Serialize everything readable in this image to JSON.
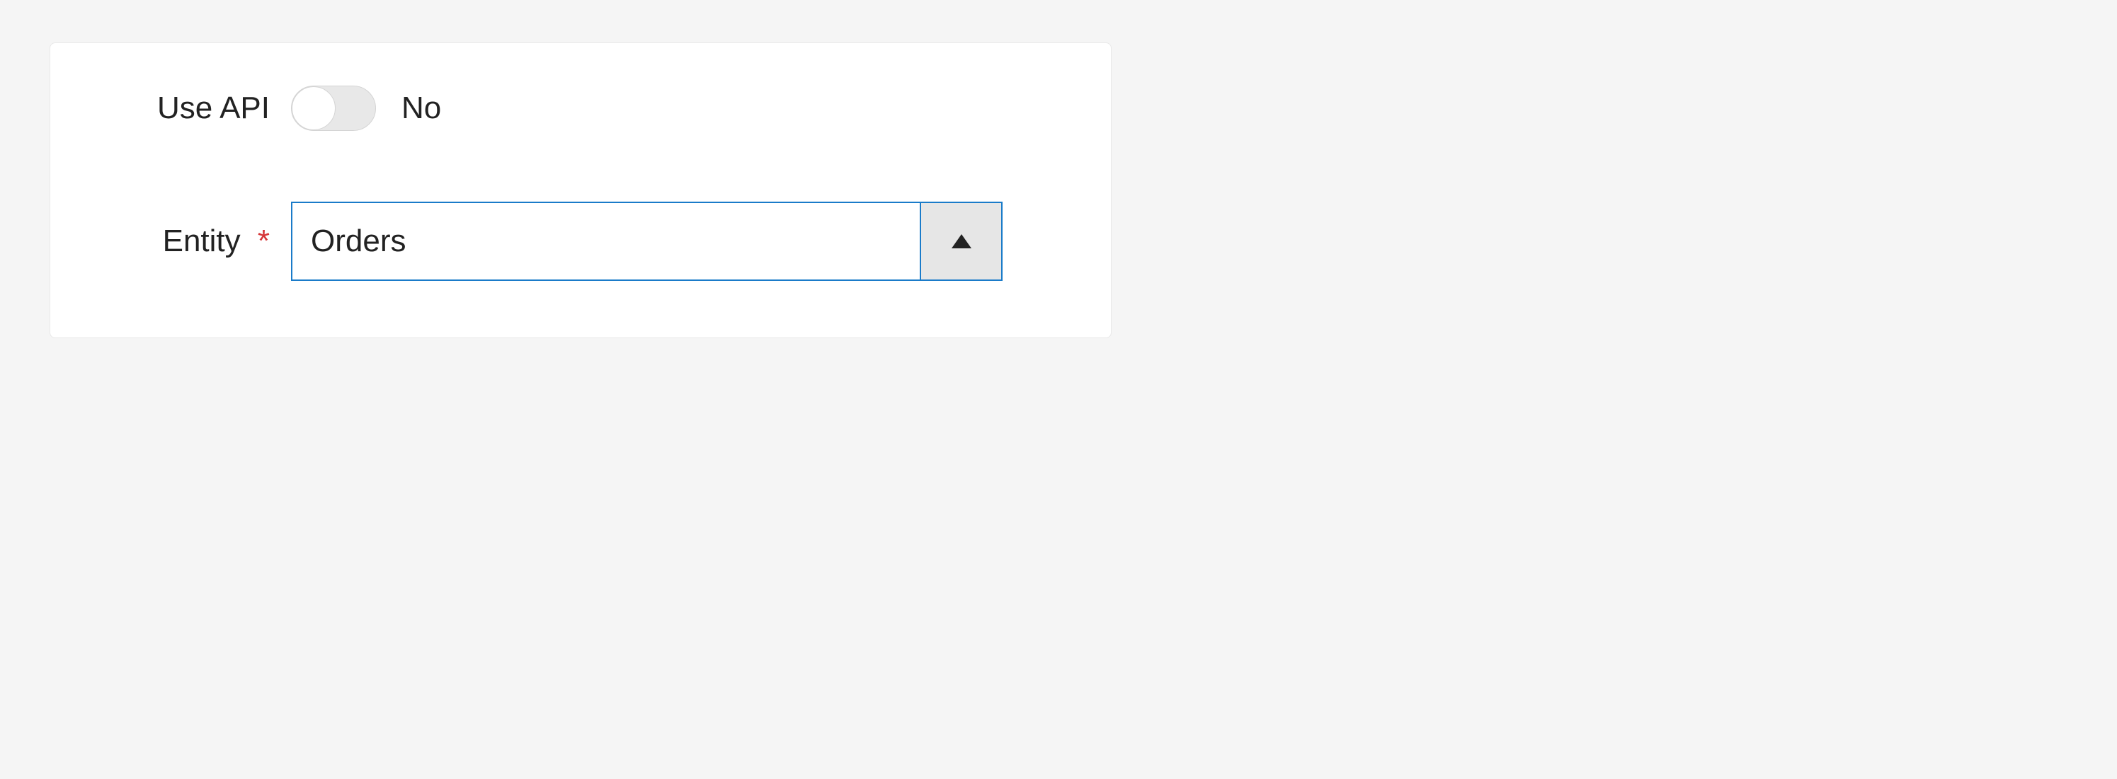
{
  "form": {
    "use_api": {
      "label": "Use API",
      "state_text": "No"
    },
    "entity": {
      "label": "Entity",
      "selected": "Orders"
    }
  }
}
